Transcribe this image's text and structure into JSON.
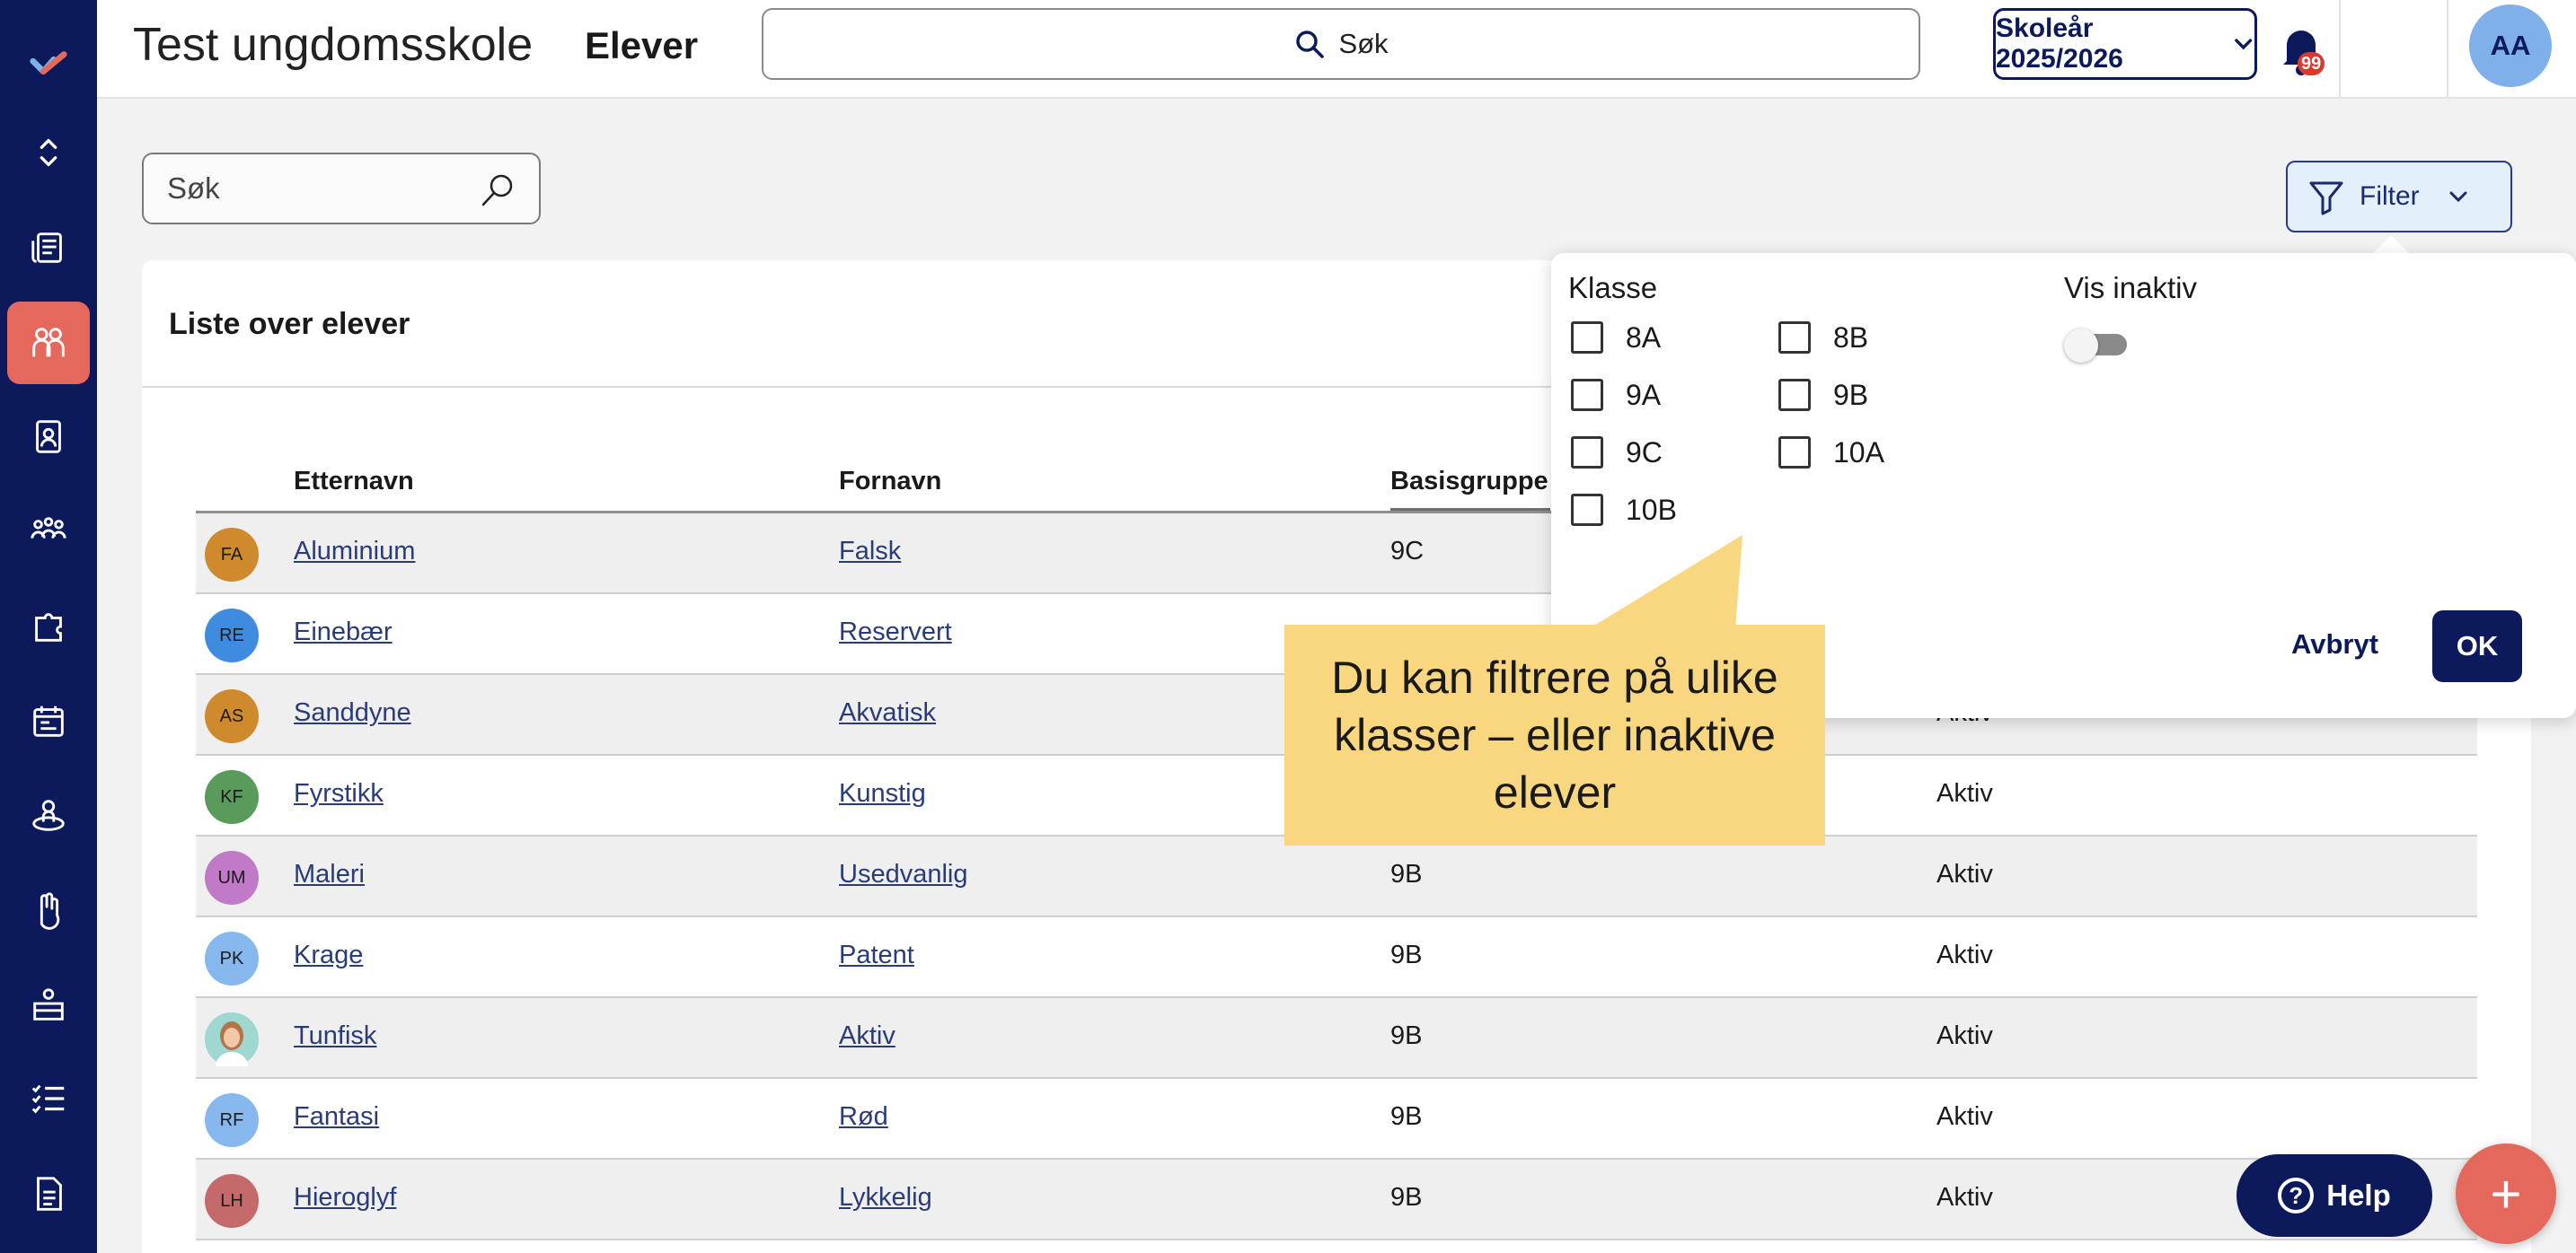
{
  "header": {
    "app_title": "Test ungdomsskole",
    "page_title": "Elever",
    "search_label": "Søk",
    "school_year": "Skoleår 2025/2026",
    "notification_count": "99",
    "user_initials": "AA"
  },
  "sidebar": {
    "items": [
      {
        "icon": "expand-collapse-icon"
      },
      {
        "icon": "news-icon"
      },
      {
        "icon": "students-icon",
        "active": true
      },
      {
        "icon": "id-badge-icon"
      },
      {
        "icon": "groups-icon"
      },
      {
        "icon": "puzzle-icon"
      },
      {
        "icon": "calendar-chat-icon"
      },
      {
        "icon": "person-orbit-icon"
      },
      {
        "icon": "hand-icon"
      },
      {
        "icon": "desk-icon"
      },
      {
        "icon": "checklist-icon"
      },
      {
        "icon": "document-icon"
      }
    ],
    "accent_color": "#e5685c",
    "background": "#0c1a5c"
  },
  "list": {
    "search_placeholder": "Søk",
    "filter_label": "Filter",
    "title": "Liste over elever",
    "columns": [
      "Etternavn",
      "Fornavn",
      "Basisgruppe"
    ],
    "rows": [
      {
        "initials": "FA",
        "color": "#d08a2e",
        "last": "Aluminium",
        "first": "Falsk",
        "group": "9C",
        "status": ""
      },
      {
        "initials": "RE",
        "color": "#3f8be0",
        "last": "Einebær",
        "first": "Reservert",
        "group": "",
        "status": ""
      },
      {
        "initials": "AS",
        "color": "#d08a2e",
        "last": "Sanddyne",
        "first": "Akvatisk",
        "group": "",
        "status": "Aktiv"
      },
      {
        "initials": "KF",
        "color": "#5a9a5a",
        "last": "Fyrstikk",
        "first": "Kunstig",
        "group": "",
        "status": "Aktiv"
      },
      {
        "initials": "UM",
        "color": "#c07ac8",
        "last": "Maleri",
        "first": "Usedvanlig",
        "group": "9B",
        "status": "Aktiv"
      },
      {
        "initials": "PK",
        "color": "#86b8ee",
        "last": "Krage",
        "first": "Patent",
        "group": "9B",
        "status": "Aktiv"
      },
      {
        "initials": "",
        "color": "#9fd8d0",
        "last": "Tunfisk",
        "first": "Aktiv",
        "group": "9B",
        "status": "Aktiv"
      },
      {
        "initials": "RF",
        "color": "#86b8ee",
        "last": "Fantasi",
        "first": "Rød",
        "group": "9B",
        "status": "Aktiv"
      },
      {
        "initials": "LH",
        "color": "#c56a6a",
        "last": "Hieroglyf",
        "first": "Lykkelig",
        "group": "9B",
        "status": "Aktiv"
      }
    ]
  },
  "filter_popover": {
    "class_label": "Klasse",
    "classes": [
      "8A",
      "8B",
      "9A",
      "9B",
      "9C",
      "10A",
      "10B"
    ],
    "inactive_label": "Vis inaktiv",
    "inactive_on": false,
    "cancel_label": "Avbryt",
    "ok_label": "OK"
  },
  "callout": {
    "text": "Du kan filtrere på ulike klasser – eller inaktive elever",
    "color": "#f9d680"
  },
  "help_label": "Help",
  "fab_label": "+"
}
